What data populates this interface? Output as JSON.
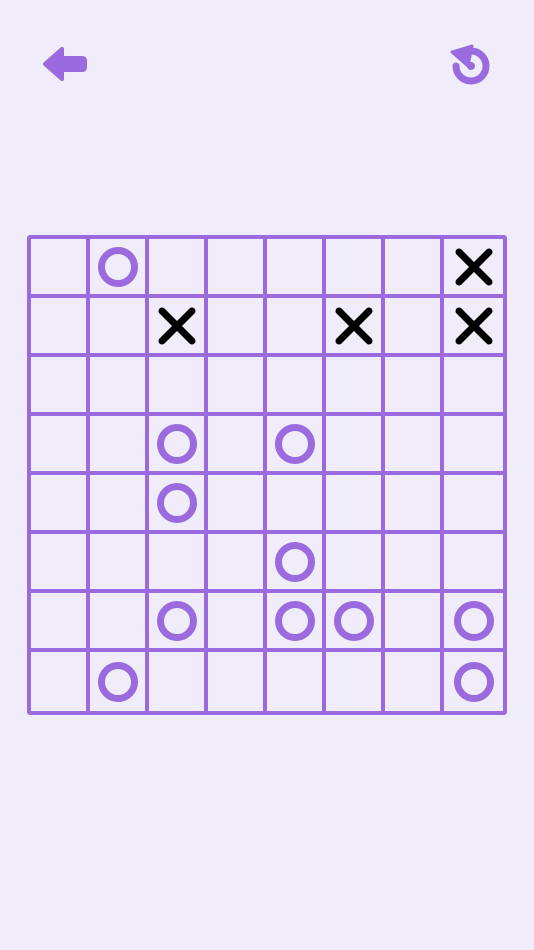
{
  "colors": {
    "background": "#f0ecf9",
    "accent": "#9a6ade",
    "x_mark": "#000000",
    "o_mark": "#9a6ade"
  },
  "toolbar": {
    "back_icon": "arrow-left-icon",
    "restart_icon": "restart-icon"
  },
  "board": {
    "size": 8,
    "rows": [
      [
        "",
        "O",
        "",
        "",
        "",
        "",
        "",
        "X"
      ],
      [
        "",
        "",
        "X",
        "",
        "",
        "X",
        "",
        "X"
      ],
      [
        "",
        "",
        "",
        "",
        "",
        "",
        "",
        ""
      ],
      [
        "",
        "",
        "O",
        "",
        "O",
        "",
        "",
        ""
      ],
      [
        "",
        "",
        "O",
        "",
        "",
        "",
        "",
        ""
      ],
      [
        "",
        "",
        "",
        "",
        "O",
        "",
        "",
        ""
      ],
      [
        "",
        "",
        "O",
        "",
        "O",
        "O",
        "",
        "O"
      ],
      [
        "",
        "O",
        "",
        "",
        "",
        "",
        "",
        "O"
      ]
    ]
  }
}
